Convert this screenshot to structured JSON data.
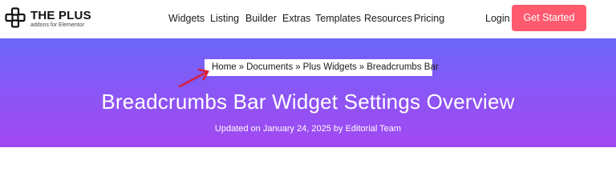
{
  "header": {
    "logo": {
      "title": "THE PLUS",
      "subtitle": "addons for Elementor",
      "icon": "plus-cross-logo-icon"
    },
    "nav": [
      {
        "label": "Widgets"
      },
      {
        "label": "Listing"
      },
      {
        "label": "Builder"
      },
      {
        "label": "Extras"
      },
      {
        "label": "Templates"
      },
      {
        "label": "Resources"
      },
      {
        "label": "Pricing"
      }
    ],
    "login_label": "Login",
    "cta_label": "Get Started"
  },
  "hero": {
    "breadcrumb": {
      "items": [
        "Home",
        "Documents",
        "Plus Widgets"
      ],
      "separator": "»",
      "current": "Breadcrumbs Bar"
    },
    "annotation_icon": "red-arrow-icon",
    "title": "Breadcrumbs Bar Widget Settings Overview",
    "meta": "Updated on January 24, 2025 by Editorial Team"
  },
  "colors": {
    "accent": "#ff5a6e",
    "hero_gradient_start": "#6a66f9",
    "hero_gradient_end": "#a348f2",
    "annotation_arrow": "#d81e3a"
  }
}
